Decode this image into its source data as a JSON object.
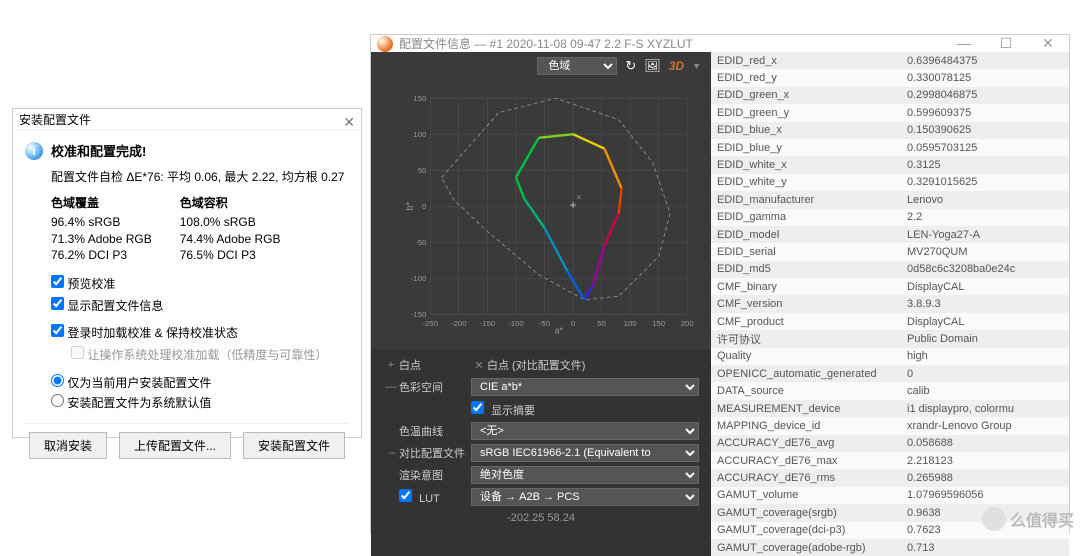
{
  "install": {
    "title": "安装配置文件",
    "heading": "校准和配置完成!",
    "summary": "配置文件自检 ΔE*76: 平均 0.06, 最大 2.22, 均方根 0.27",
    "coverage_header": "色域覆盖",
    "volume_header": "色域容积",
    "coverage": {
      "srgb": "96.4% sRGB",
      "adobe": "71.3% Adobe RGB",
      "dcip3": "76.2% DCI P3"
    },
    "volume": {
      "srgb": "108.0% sRGB",
      "adobe": "74.4% Adobe RGB",
      "dcip3": "76.5% DCI P3"
    },
    "checks": {
      "preview": "预览校准",
      "show_profile": "显示配置文件信息",
      "load_on_login": "登录时加载校准 & 保持校准状态",
      "os_handle": "让操作系统处理校准加载（低精度与可靠性）"
    },
    "radios": {
      "current_user": "仅为当前用户安装配置文件",
      "system_default": "安装配置文件为系统默认值"
    },
    "buttons": {
      "cancel": "取消安装",
      "upload": "上传配置文件...",
      "install": "安装配置文件"
    }
  },
  "profile": {
    "title": "配置文件信息 — #1 2020-11-08 09-47 2.2 F-S XYZLUT",
    "toolbar_select": "色域",
    "toolbar_3d": "3D",
    "axis_x": "a*",
    "axis_y": "b*",
    "whitepoint_label": "白点",
    "compare_whitepoint_label": "白点 (对比配置文件)",
    "colorspace_label": "色彩空间",
    "colorspace_value": "CIE a*b*",
    "show_summary_label": "显示摘要",
    "trc_label": "色温曲线",
    "trc_value": "<无>",
    "compare_profile_label": "对比配置文件",
    "compare_profile_value": "sRGB IEC61966-2.1 (Equivalent to",
    "rendering_label": "渲染意图",
    "rendering_value": "绝对色度",
    "lut_label": "LUT",
    "lut_value": "设备 → A2B → PCS",
    "status": "-202.25 58.24"
  },
  "chart_data": {
    "type": "line",
    "title": "色域",
    "xlabel": "a*",
    "ylabel": "b*",
    "xlim": [
      -250,
      200
    ],
    "ylim": [
      -150,
      150
    ],
    "xticks": [
      -250,
      -200,
      -150,
      -100,
      -50,
      0,
      50,
      100,
      150,
      200
    ],
    "yticks": [
      -150,
      -100,
      -50,
      0,
      50,
      100,
      150
    ],
    "series": [
      {
        "name": "profile_gamut",
        "points": [
          [
            -100,
            40
          ],
          [
            -60,
            95
          ],
          [
            0,
            100
          ],
          [
            55,
            80
          ],
          [
            85,
            25
          ],
          [
            80,
            -10
          ],
          [
            55,
            -55
          ],
          [
            35,
            -110
          ],
          [
            20,
            -130
          ],
          [
            -10,
            -90
          ],
          [
            -50,
            -30
          ],
          [
            -85,
            10
          ],
          [
            -100,
            40
          ]
        ]
      },
      {
        "name": "reference_gamut",
        "points": [
          [
            -230,
            40
          ],
          [
            -130,
            130
          ],
          [
            -30,
            150
          ],
          [
            80,
            120
          ],
          [
            140,
            60
          ],
          [
            170,
            -10
          ],
          [
            150,
            -70
          ],
          [
            80,
            -125
          ],
          [
            20,
            -130
          ],
          [
            -60,
            -95
          ],
          [
            -150,
            -35
          ],
          [
            -210,
            10
          ],
          [
            -230,
            40
          ]
        ]
      }
    ],
    "white_point": [
      0,
      0
    ]
  },
  "info_rows": [
    {
      "key": "EDID_red_x",
      "value": "0.6396484375"
    },
    {
      "key": "EDID_red_y",
      "value": "0.330078125"
    },
    {
      "key": "EDID_green_x",
      "value": "0.2998046875"
    },
    {
      "key": "EDID_green_y",
      "value": "0.599609375"
    },
    {
      "key": "EDID_blue_x",
      "value": "0.150390625"
    },
    {
      "key": "EDID_blue_y",
      "value": "0.0595703125"
    },
    {
      "key": "EDID_white_x",
      "value": "0.3125"
    },
    {
      "key": "EDID_white_y",
      "value": "0.3291015625"
    },
    {
      "key": "EDID_manufacturer",
      "value": "Lenovo"
    },
    {
      "key": "EDID_gamma",
      "value": "2.2"
    },
    {
      "key": "EDID_model",
      "value": "LEN-Yoga27-A"
    },
    {
      "key": "EDID_serial",
      "value": "MV270QUM"
    },
    {
      "key": "EDID_md5",
      "value": "0d58c6c3208ba0e24c"
    },
    {
      "key": "CMF_binary",
      "value": "DisplayCAL"
    },
    {
      "key": "CMF_version",
      "value": "3.8.9.3"
    },
    {
      "key": "CMF_product",
      "value": "DisplayCAL"
    },
    {
      "key": "许可协议",
      "value": "Public Domain"
    },
    {
      "key": "Quality",
      "value": "high"
    },
    {
      "key": "OPENICC_automatic_generated",
      "value": "0"
    },
    {
      "key": "DATA_source",
      "value": "calib"
    },
    {
      "key": "MEASUREMENT_device",
      "value": "i1 displaypro, colormu"
    },
    {
      "key": "MAPPING_device_id",
      "value": "xrandr-Lenovo Group"
    },
    {
      "key": "ACCURACY_dE76_avg",
      "value": "0.058688"
    },
    {
      "key": "ACCURACY_dE76_max",
      "value": "2.218123"
    },
    {
      "key": "ACCURACY_dE76_rms",
      "value": "0.265988"
    },
    {
      "key": "GAMUT_volume",
      "value": "1.07969596056"
    },
    {
      "key": "GAMUT_coverage(srgb)",
      "value": "0.9638"
    },
    {
      "key": "GAMUT_coverage(dci-p3)",
      "value": "0.7623"
    },
    {
      "key": "GAMUT_coverage(adobe-rgb)",
      "value": "0.713"
    }
  ],
  "watermark": "么值得买"
}
